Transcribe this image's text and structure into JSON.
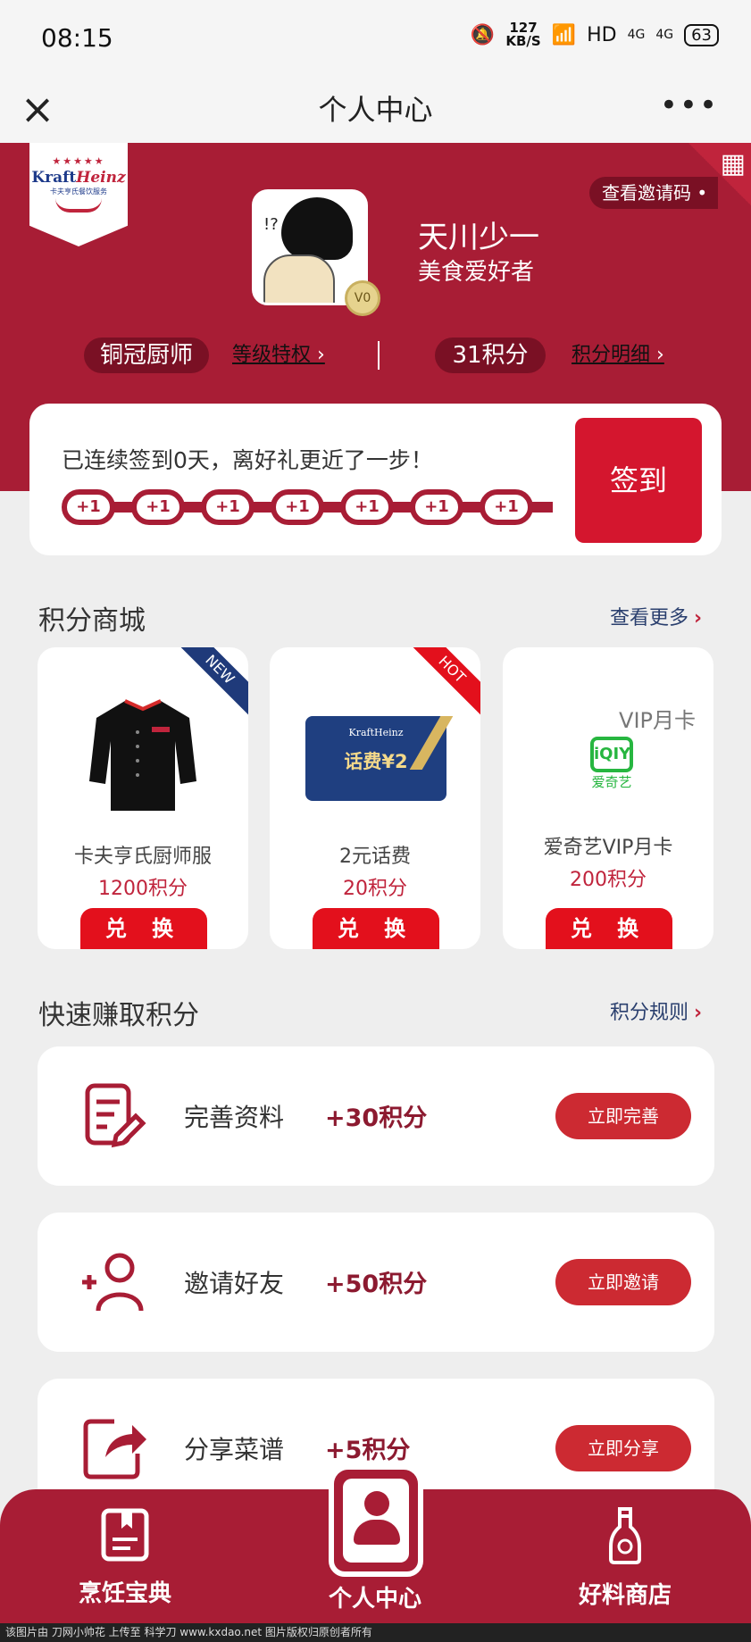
{
  "status_bar": {
    "time": "08:15",
    "speed_value": "127",
    "speed_unit": "KB/S",
    "network": "HD",
    "signal1": "4G",
    "signal2": "4G",
    "battery": "63"
  },
  "nav": {
    "close_icon": "close-icon",
    "title": "个人中心",
    "more_icon": "more-icon"
  },
  "hero": {
    "logo_brand": "Kraft",
    "logo_brand2": "Heinz",
    "logo_sub": "卡夫亨氏餐饮服务",
    "invite_label": "查看邀请码",
    "username": "天川少一",
    "user_title": "美食爱好者",
    "vip_badge": "V0",
    "level": "铜冠厨师",
    "level_link": "等级特权",
    "points": "31积分",
    "points_link": "积分明细"
  },
  "signin": {
    "message": "已连续签到0天，离好礼更近了一步！",
    "nodes": [
      "+1",
      "+1",
      "+1",
      "+1",
      "+1",
      "+1",
      "+1"
    ],
    "button": "签到"
  },
  "shop": {
    "title": "积分商城",
    "more": "查看更多",
    "items": [
      {
        "name": "卡夫亨氏厨师服",
        "points": "1200积分",
        "button": "兑 换",
        "ribbon": "NEW"
      },
      {
        "name": "2元话费",
        "points": "20积分",
        "button": "兑 换",
        "ribbon": "HOT",
        "card_brand": "KraftHeinz",
        "card_value": "话费¥2"
      },
      {
        "name": "爱奇艺VIP月卡",
        "points": "200积分",
        "button": "兑 换",
        "overlay": "VIP月卡",
        "logo": "iQIY",
        "logo_zh": "爱奇艺"
      }
    ]
  },
  "earn": {
    "title": "快速赚取积分",
    "rules": "积分规则",
    "tasks": [
      {
        "name": "完善资料",
        "points": "+30积分",
        "button": "立即完善",
        "icon": "edit-document-icon"
      },
      {
        "name": "邀请好友",
        "points": "+50积分",
        "button": "立即邀请",
        "icon": "add-user-icon"
      },
      {
        "name": "分享菜谱",
        "points": "+5积分",
        "button": "立即分享",
        "icon": "share-icon"
      }
    ]
  },
  "bottom_nav": {
    "items": [
      {
        "label": "烹饪宝典",
        "icon": "book-icon"
      },
      {
        "label": "个人中心",
        "icon": "user-icon"
      },
      {
        "label": "好料商店",
        "icon": "bottle-icon"
      }
    ]
  },
  "footer": "该图片由 刀网小帅花 上传至 科学刀 www.kxdao.net 图片版权归原创者所有",
  "colors": {
    "primary": "#a81d35",
    "button_red": "#d4162e",
    "link_blue": "#2a3f6e"
  }
}
